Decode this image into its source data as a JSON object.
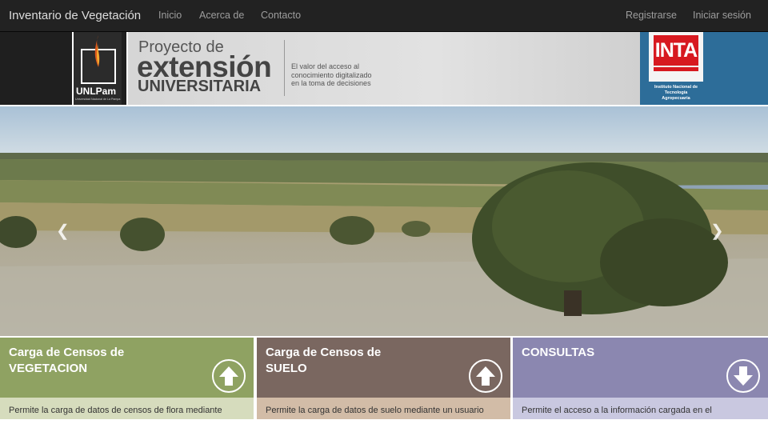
{
  "navbar": {
    "brand": "Inventario de Vegetación",
    "links": [
      "Inicio",
      "Acerca de",
      "Contacto"
    ],
    "register": "Registrarse",
    "login": "Iniciar sesión"
  },
  "banner": {
    "unlpam": {
      "name": "UNLPam",
      "subtitle": "Universidad Nacional de La Pampa"
    },
    "project": {
      "line1": "Proyecto de",
      "line2": "extensión",
      "line3": "UNIVERSITARIA",
      "motto": "El valor del acceso al conocimiento digitalizado en la toma de decisiones"
    },
    "inta": {
      "name": "INTA",
      "subtitle": "Instituto Nacional de Tecnología Agropecuaria"
    }
  },
  "carousel": {
    "prev_icon": "chevron-left-icon",
    "next_icon": "chevron-right-icon"
  },
  "cards": [
    {
      "title1": "Carga de Censos de",
      "title2": "VEGETACION",
      "desc": "Permite la carga de datos de censos de flora mediante",
      "icon": "arrow-up-icon",
      "color_head": "#8fa262",
      "color_body": "#d6dcbd"
    },
    {
      "title1": "Carga de Censos de",
      "title2": "SUELO",
      "desc": "Permite la carga de datos de suelo mediante un usuario",
      "icon": "arrow-up-icon",
      "color_head": "#7a6760",
      "color_body": "#d2bca7"
    },
    {
      "title1": "CONSULTAS",
      "title2": "",
      "desc": "Permite el acceso a la información cargada en el",
      "icon": "arrow-down-icon",
      "color_head": "#8b87b0",
      "color_body": "#c9c8e0"
    }
  ]
}
